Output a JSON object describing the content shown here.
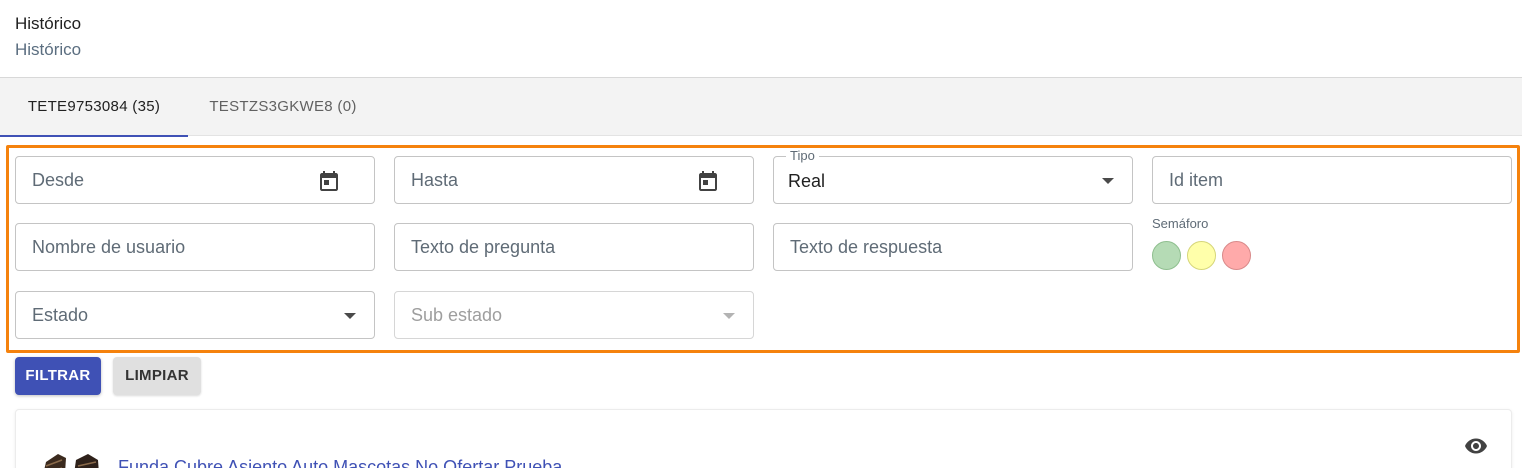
{
  "header": {
    "title": "Histórico",
    "subtitle": "Histórico"
  },
  "tabs": [
    {
      "label": "TETE9753084 (35)",
      "active": true
    },
    {
      "label": "TESTZS3GKWE8 (0)",
      "active": false
    }
  ],
  "filters": {
    "desde": {
      "placeholder": "Desde",
      "icon": "calendar-icon"
    },
    "hasta": {
      "placeholder": "Hasta",
      "icon": "calendar-icon"
    },
    "tipo": {
      "label": "Tipo",
      "value": "Real"
    },
    "id_item": {
      "placeholder": "Id item"
    },
    "nombre_usuario": {
      "placeholder": "Nombre de usuario"
    },
    "texto_pregunta": {
      "placeholder": "Texto de pregunta"
    },
    "texto_respuesta": {
      "placeholder": "Texto de respuesta"
    },
    "semaforo": {
      "label": "Semáforo",
      "colors": [
        "#b5dbb5",
        "#ffffaa",
        "#ffaaaa"
      ]
    },
    "estado": {
      "placeholder": "Estado"
    },
    "sub_estado": {
      "placeholder": "Sub estado",
      "disabled": true
    }
  },
  "actions": {
    "filter_label": "FILTRAR",
    "clear_label": "LIMPIAR"
  },
  "results": [
    {
      "title": "Funda Cubre Asiento Auto Mascotas No Ofertar Prueba",
      "icon": "eye-icon"
    }
  ],
  "colors": {
    "primary": "#3f51b5",
    "highlight_border": "#f5820d"
  }
}
